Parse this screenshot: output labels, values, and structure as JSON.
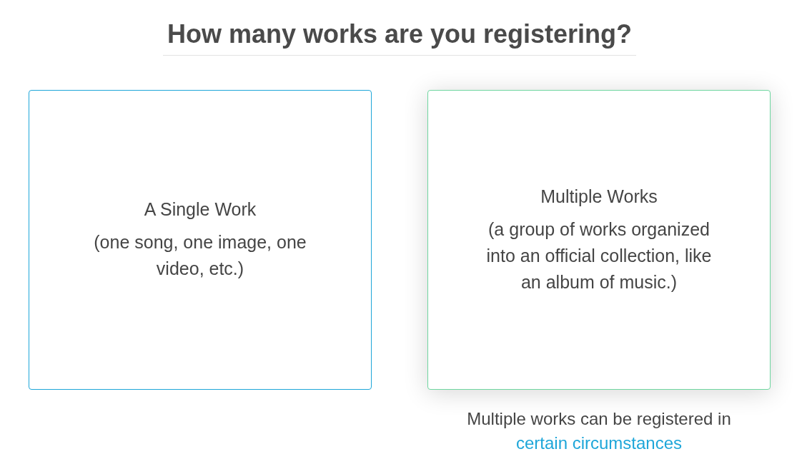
{
  "heading": "How many works are you registering?",
  "options": [
    {
      "title": "A Single Work",
      "description": "(one song, one image, one video, etc.)",
      "color": "#1ea6d9",
      "highlighted": false
    },
    {
      "title": "Multiple Works",
      "description": "(a group of works organized into an official collection, like an album of music.)",
      "color": "#6fd6a0",
      "highlighted": true
    }
  ],
  "note": {
    "text": "Multiple works can be registered in",
    "link": "certain circumstances"
  }
}
